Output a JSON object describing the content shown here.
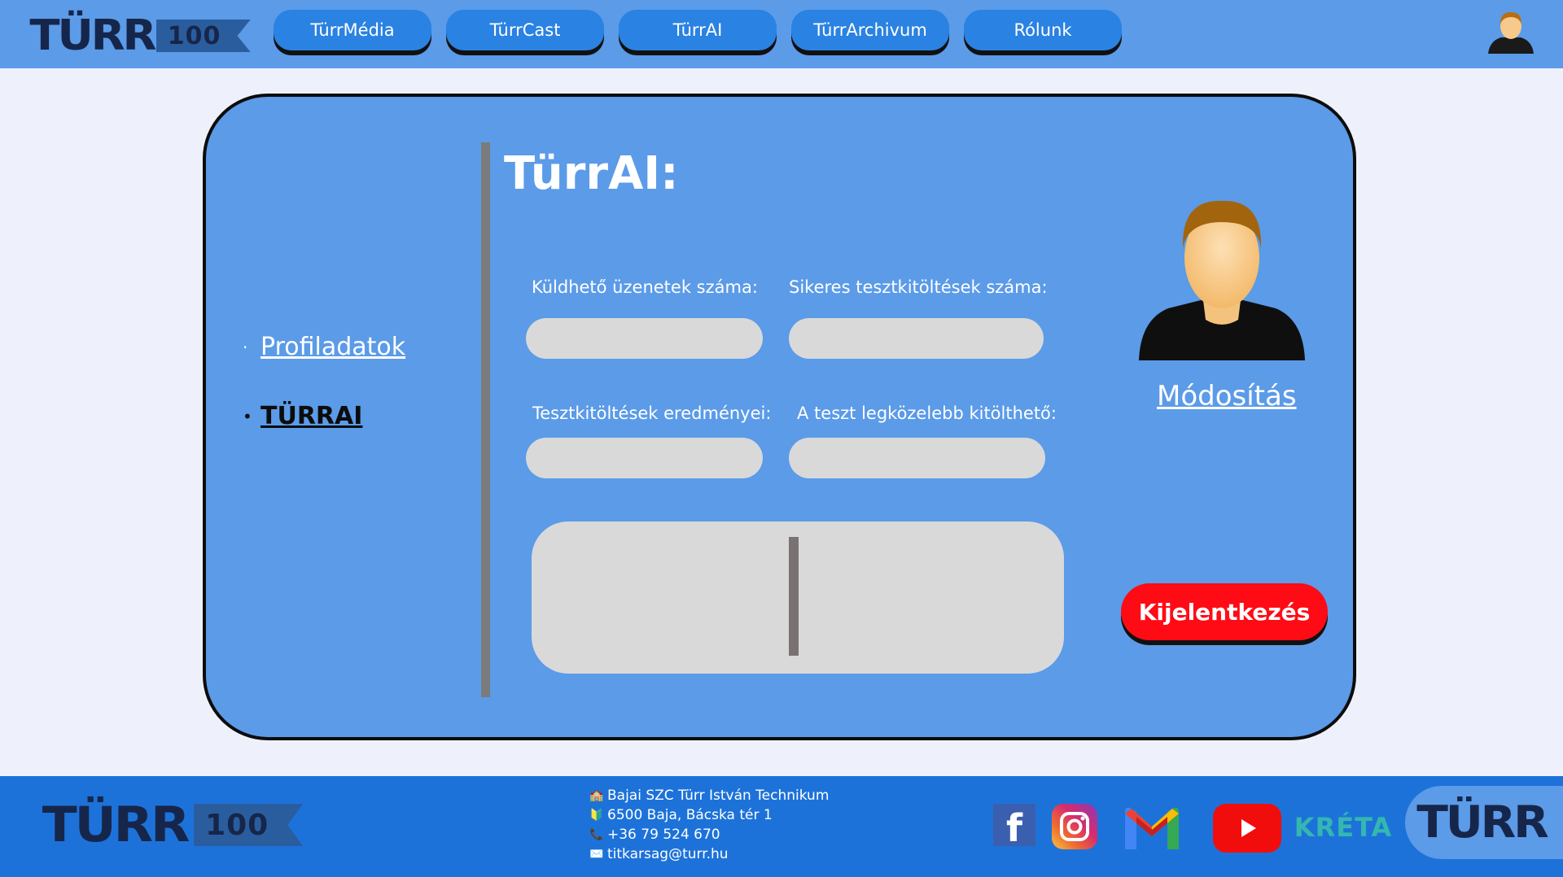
{
  "header": {
    "logo_text": "TÜRR",
    "logo_number": "100",
    "nav": [
      {
        "label": "TürrMédia"
      },
      {
        "label": "TürrCast"
      },
      {
        "label": "TürrAI"
      },
      {
        "label": "TürrArchivum"
      },
      {
        "label": "Rólunk"
      }
    ],
    "avatar_icon": "user-avatar-icon"
  },
  "sidebar": {
    "items": [
      {
        "label": "Profiladatok",
        "active": false
      },
      {
        "label": "TÜRRAI",
        "active": true
      }
    ]
  },
  "main": {
    "title": "TürrAI:",
    "fields": {
      "messages_label": "Küldhető üzenetek száma:",
      "messages_value": "",
      "successful_label": "Sikeres tesztkitöltések száma:",
      "successful_value": "",
      "results_label": "Tesztkitöltések eredményei:",
      "results_value": "",
      "next_test_label": "A teszt legközelebb kitölthető:",
      "next_test_value": ""
    }
  },
  "profile": {
    "picture_icon": "profile-avatar-icon",
    "modify_label": "Módosítás",
    "logout_label": "Kijelentkezés"
  },
  "footer": {
    "logo_text": "TÜRR",
    "logo_number": "100",
    "contact": [
      {
        "icon": "🏫",
        "text": "Bajai SZC Türr István Technikum"
      },
      {
        "icon": "🔰",
        "text": "6500 Baja, Bácska tér 1"
      },
      {
        "icon": "📞",
        "text": "+36 79 524 670"
      },
      {
        "icon": "✉️",
        "text": "titkarsag@turr.hu"
      }
    ],
    "social": {
      "facebook_letter": "f",
      "kreta_text": "KRÉTA"
    },
    "badge_text": "TÜRR"
  },
  "colors": {
    "header_bg": "#5b9be8",
    "nav_button": "#2a82e2",
    "card_bg": "#5b9be8",
    "input_bg": "#d9d9d9",
    "logout_bg": "#ff0b16",
    "footer_bg": "#1d72d9",
    "page_bg": "#eef1fb"
  }
}
